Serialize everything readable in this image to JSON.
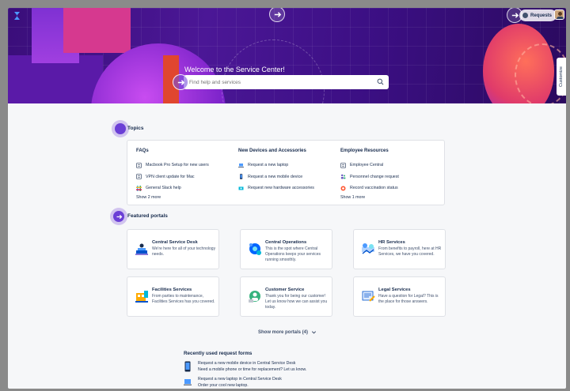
{
  "header": {
    "requests_label": "Requests",
    "customize_label": "Customize"
  },
  "hero": {
    "welcome": "Welcome to the Service Center!",
    "search_placeholder": "Find help and services"
  },
  "topics": {
    "title": "Topics",
    "columns": [
      {
        "title": "FAQs",
        "items": [
          "Macbook Pro Setup for new users",
          "VPN client update for Mac",
          "General Slack help"
        ],
        "show_more": "Show 2 more"
      },
      {
        "title": "New Devices and Accessories",
        "items": [
          "Request a new laptop",
          "Request a new mobile device",
          "Request new hardware accessories"
        ],
        "show_more": ""
      },
      {
        "title": "Employee Resources",
        "items": [
          "Employee Central",
          "Personnel change request",
          "Record vaccination status"
        ],
        "show_more": "Show 1 more"
      }
    ]
  },
  "portals": {
    "title": "Featured portals",
    "cards": [
      {
        "title": "Central Service Desk",
        "desc": "We're here for all of your technology needs."
      },
      {
        "title": "Central Operations",
        "desc": "This is the spot where Central Operations keeps your services running smoothly."
      },
      {
        "title": "HR Services",
        "desc": "From benefits to payroll, here at HR Services, we have you covered."
      },
      {
        "title": "Facilities Services",
        "desc": "From parties to maintenance, Facilities Services has you covered."
      },
      {
        "title": "Customer Service",
        "desc": "Thank you for being our customer! Let us know how we can assist you today."
      },
      {
        "title": "Legal Services",
        "desc": "Have a question for Legal? This is the place for those answers."
      }
    ],
    "show_more": "Show more portals (4)"
  },
  "recent": {
    "title": "Recently used request forms",
    "items": [
      {
        "line1": "Request a new mobile device in Central Service Desk",
        "line2": "Need a mobile phone or time for replacement? Let us know."
      },
      {
        "line1": "Request a new laptop in Central Service Desk",
        "line2": "Order your cool new laptop."
      }
    ]
  },
  "colors": {
    "accent": "#6b3fd6",
    "hero_bg": "#3a0e7a",
    "text": "#172b4d"
  }
}
